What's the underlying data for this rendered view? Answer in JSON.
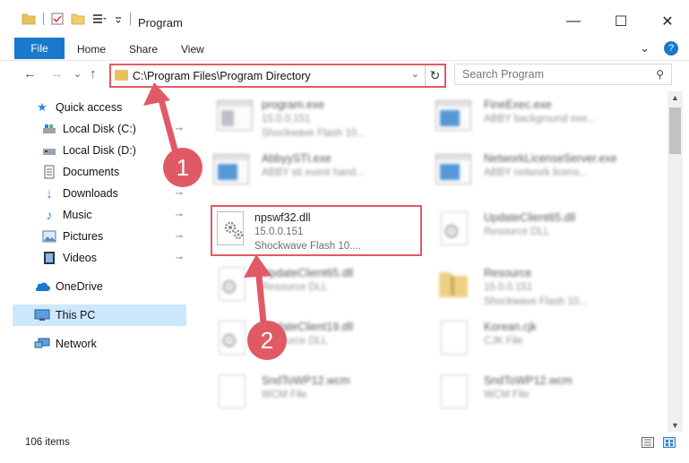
{
  "window": {
    "title": "Program",
    "minimize_glyph": "—",
    "maximize_glyph": "☐",
    "close_glyph": "✕"
  },
  "ribbon": {
    "file_tab": "File",
    "tabs": [
      "Home",
      "Share",
      "View"
    ],
    "expand_glyph": "⌄",
    "help_glyph": "?"
  },
  "navigation": {
    "back_glyph": "←",
    "forward_glyph": "→",
    "recent_glyph": "⌄",
    "up_glyph": "↑",
    "address": "C:\\Program Files\\Program Directory",
    "address_dropdown_glyph": "⌄",
    "refresh_glyph": "↻",
    "search_placeholder": "Search Program",
    "search_glyph": "⚲"
  },
  "sidebar": {
    "quick_access": {
      "label": "Quick access",
      "icon": "star-icon"
    },
    "items": [
      {
        "label": "Local Disk (C:)",
        "icon": "drive-icon",
        "pinned": true
      },
      {
        "label": "Local Disk (D:)",
        "icon": "drive-icon",
        "pinned": false
      },
      {
        "label": "Documents",
        "icon": "documents-icon",
        "pinned": true
      },
      {
        "label": "Downloads",
        "icon": "download-icon",
        "pinned": true
      },
      {
        "label": "Music",
        "icon": "music-icon",
        "pinned": true
      },
      {
        "label": "Pictures",
        "icon": "pictures-icon",
        "pinned": true
      },
      {
        "label": "Videos",
        "icon": "video-icon",
        "pinned": true
      }
    ],
    "onedrive": {
      "label": "OneDrive",
      "icon": "cloud-icon"
    },
    "this_pc": {
      "label": "This PC",
      "icon": "computer-icon",
      "selected": true
    },
    "network": {
      "label": "Network",
      "icon": "network-icon"
    },
    "pin_glyph": "📌"
  },
  "files": [
    {
      "name": "program.exe",
      "line2": "15.0.0.151",
      "line3": "Shockwave Flash 10...",
      "icon": "exe-icon",
      "blurred": true
    },
    {
      "name": "FineExec.exe",
      "line2": "ABBY background exe...",
      "line3": "",
      "icon": "app-window-icon",
      "blurred": true
    },
    {
      "name": "AbbyySTI.exe",
      "line2": "ABBY sti event hand...",
      "line3": "",
      "icon": "app-window-icon",
      "blurred": true
    },
    {
      "name": "NetworkLicenseServer.exe",
      "line2": "ABBY network licens...",
      "line3": "",
      "icon": "app-window-icon",
      "blurred": true
    },
    {
      "name": "npswf32.dll",
      "line2": "15.0.0.151",
      "line3": "Shockwave Flash 10....",
      "icon": "dll-icon",
      "blurred": false
    },
    {
      "name": "UpdateClient65.dll",
      "line2": "Resource DLL",
      "line3": "",
      "icon": "dll-icon",
      "blurred": true
    },
    {
      "name": "UpdateClient65.dll",
      "line2": "Resource DLL",
      "line3": "",
      "icon": "dll-icon",
      "blurred": true
    },
    {
      "name": "Resource",
      "line2": "15.0.0.151",
      "line3": "Shockwave Flash 10...",
      "icon": "folder-zip-icon",
      "blurred": true
    },
    {
      "name": "UpdateClient19.dll",
      "line2": "Resource DLL",
      "line3": "",
      "icon": "dll-icon",
      "blurred": true
    },
    {
      "name": "Korean.cjk",
      "line2": "CJK File",
      "line3": "",
      "icon": "file-icon",
      "blurred": true
    },
    {
      "name": "SndToWP12.wcm",
      "line2": "WCM File",
      "line3": "",
      "icon": "file-icon",
      "blurred": true
    },
    {
      "name": "SndToWP12.wcm",
      "line2": "WCM File",
      "line3": "",
      "icon": "file-icon",
      "blurred": true
    }
  ],
  "status": {
    "item_count": "106 items"
  },
  "annotations": {
    "callout_1": "1",
    "callout_2": "2",
    "color": "#e05a66"
  },
  "colors": {
    "accent": "#1979ca",
    "selection": "#cce8ff",
    "highlight": "#e05a66"
  }
}
